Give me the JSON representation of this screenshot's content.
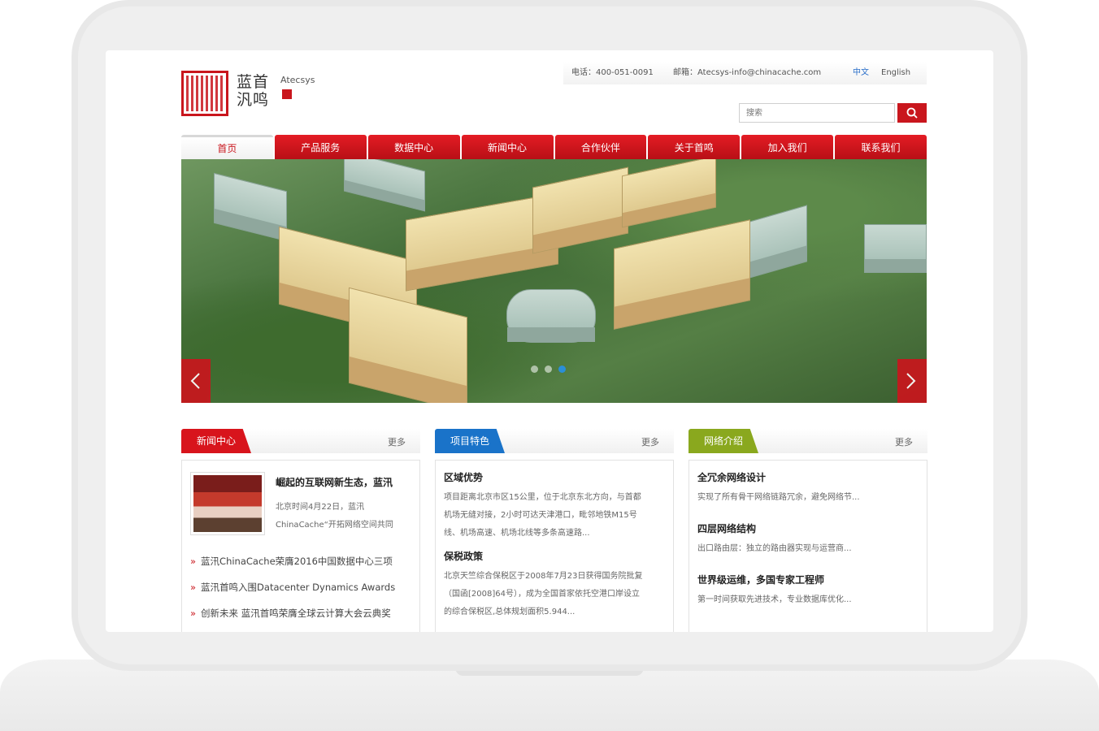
{
  "header": {
    "logo_cn": "蓝首汎鸣",
    "logo_en": "Atecsys",
    "phone": "电话：400-051-0091",
    "email": "邮箱：Atecsys-info@chinacache.com",
    "lang_cn": "中文",
    "lang_en": "English",
    "search_placeholder": "搜索"
  },
  "nav": [
    "首页",
    "产品服务",
    "数据中心",
    "新闻中心",
    "合作伙伴",
    "关于首鸣",
    "加入我们",
    "联系我们"
  ],
  "news": {
    "tab": "新闻中心",
    "more": "更多",
    "tab_color": "#d8141c",
    "featured_title": "崛起的互联网新生态，蓝汛",
    "featured_date": "北京时间4月22日，蓝汛",
    "featured_summary": "ChinaCache“开拓网络空间共同",
    "items": [
      "蓝汛ChinaCache荣膺2016中国数据中心三项",
      "蓝汛首鸣入围Datacenter Dynamics Awards",
      "创新未来 蓝汛首鸣荣膺全球云计算大会云典奖"
    ]
  },
  "project": {
    "tab": "项目特色",
    "more": "更多",
    "tab_color": "#1a73c9",
    "sections": [
      {
        "title": "区域优势",
        "lines": [
          "项目距离北京市区15公里，位于北京东北方向，与首都",
          "机场无缝对接，2小时可达天津港口，毗邻地铁M15号",
          "线、机场高速、机场北线等多条高速路..."
        ]
      },
      {
        "title": "保税政策",
        "lines": [
          "北京天竺综合保税区于2008年7月23日获得国务院批复",
          "（国函[2008]64号），成为全国首家依托空港口岸设立",
          "的综合保税区,总体规划面积5.944..."
        ]
      }
    ]
  },
  "network": {
    "tab": "网络介绍",
    "more": "更多",
    "tab_color": "#8aa81e",
    "sections": [
      {
        "title": "全冗余网络设计",
        "lines": [
          "实现了所有骨干网络链路冗余，避免网络节..."
        ]
      },
      {
        "title": "四层网络结构",
        "lines": [
          "出口路由层：独立的路由器实现与运营商..."
        ]
      },
      {
        "title": "世界级运维，多国专家工程师",
        "lines": [
          "第一时间获取先进技术，专业数据库优化..."
        ]
      }
    ]
  }
}
